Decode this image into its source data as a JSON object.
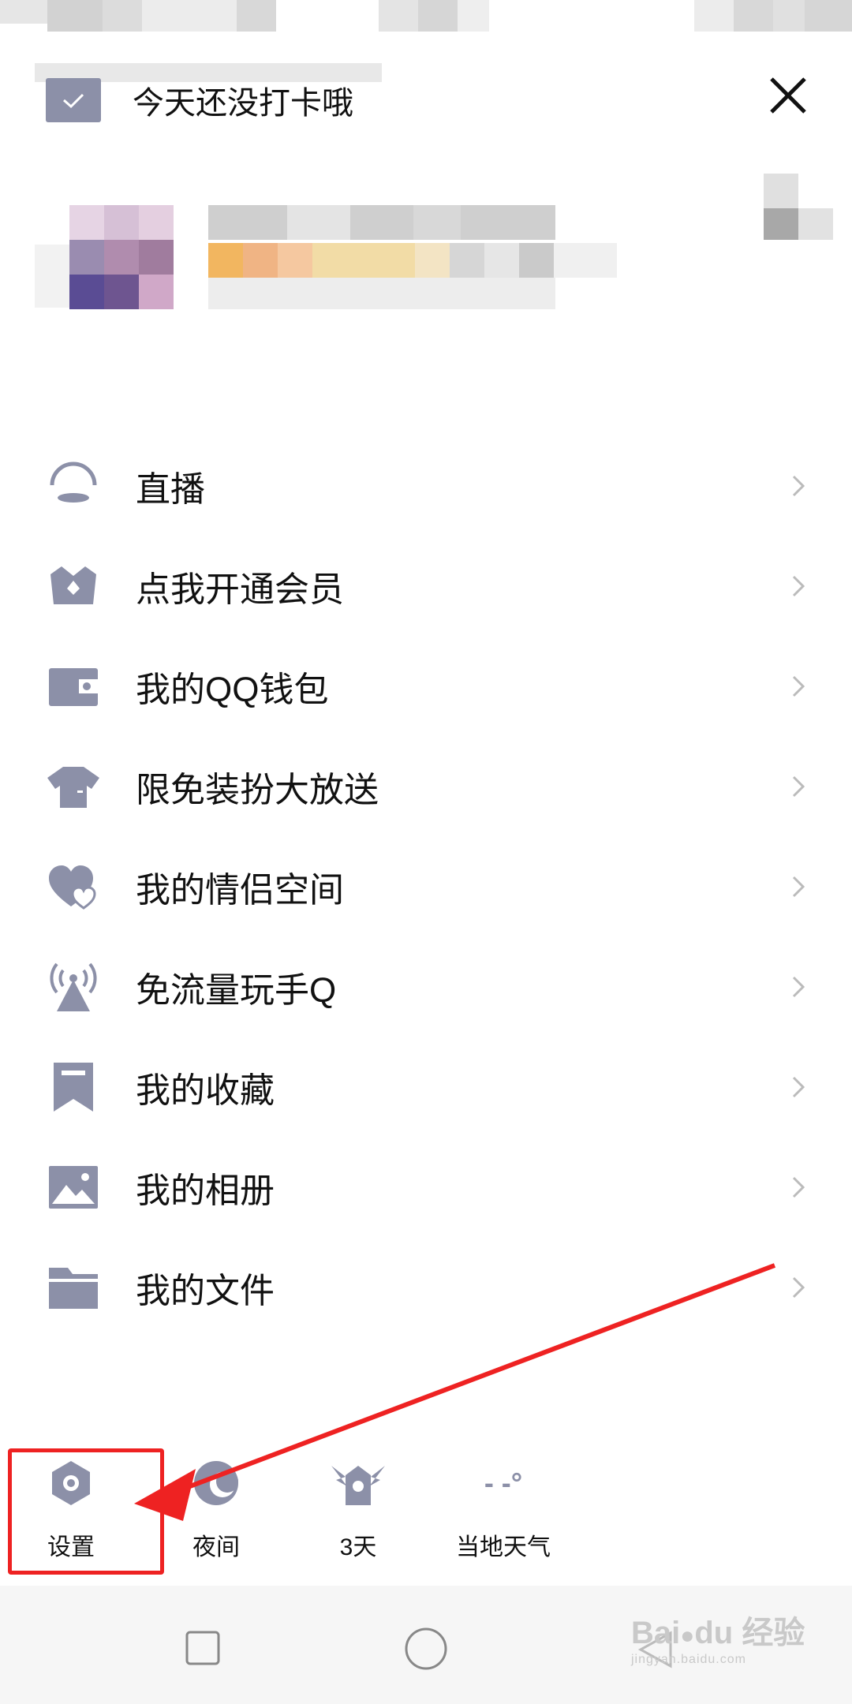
{
  "checkin": {
    "label": "今天还没打卡哦"
  },
  "menu": {
    "items": [
      {
        "label": "直播",
        "icon": "live-icon"
      },
      {
        "label": "点我开通会员",
        "icon": "vip-crown-icon"
      },
      {
        "label": "我的QQ钱包",
        "icon": "wallet-icon"
      },
      {
        "label": "限免装扮大放送",
        "icon": "tshirt-icon"
      },
      {
        "label": "我的情侣空间",
        "icon": "couple-heart-icon"
      },
      {
        "label": "免流量玩手Q",
        "icon": "signal-tower-icon"
      },
      {
        "label": "我的收藏",
        "icon": "bookmark-icon"
      },
      {
        "label": "我的相册",
        "icon": "photo-album-icon"
      },
      {
        "label": "我的文件",
        "icon": "folder-icon"
      }
    ]
  },
  "toolbar": {
    "settings_label": "设置",
    "night_label": "夜间",
    "checkin_days_label": "3天",
    "weather_label": "当地天气",
    "weather_value": "- -°"
  },
  "watermark": {
    "brand": "Bai du 经验",
    "url": "jingyan.baidu.com"
  },
  "colors": {
    "icon_gray": "#8c90a8",
    "annotation_red": "#ee2222",
    "text": "#111111",
    "chevron": "#bbbbbb"
  }
}
